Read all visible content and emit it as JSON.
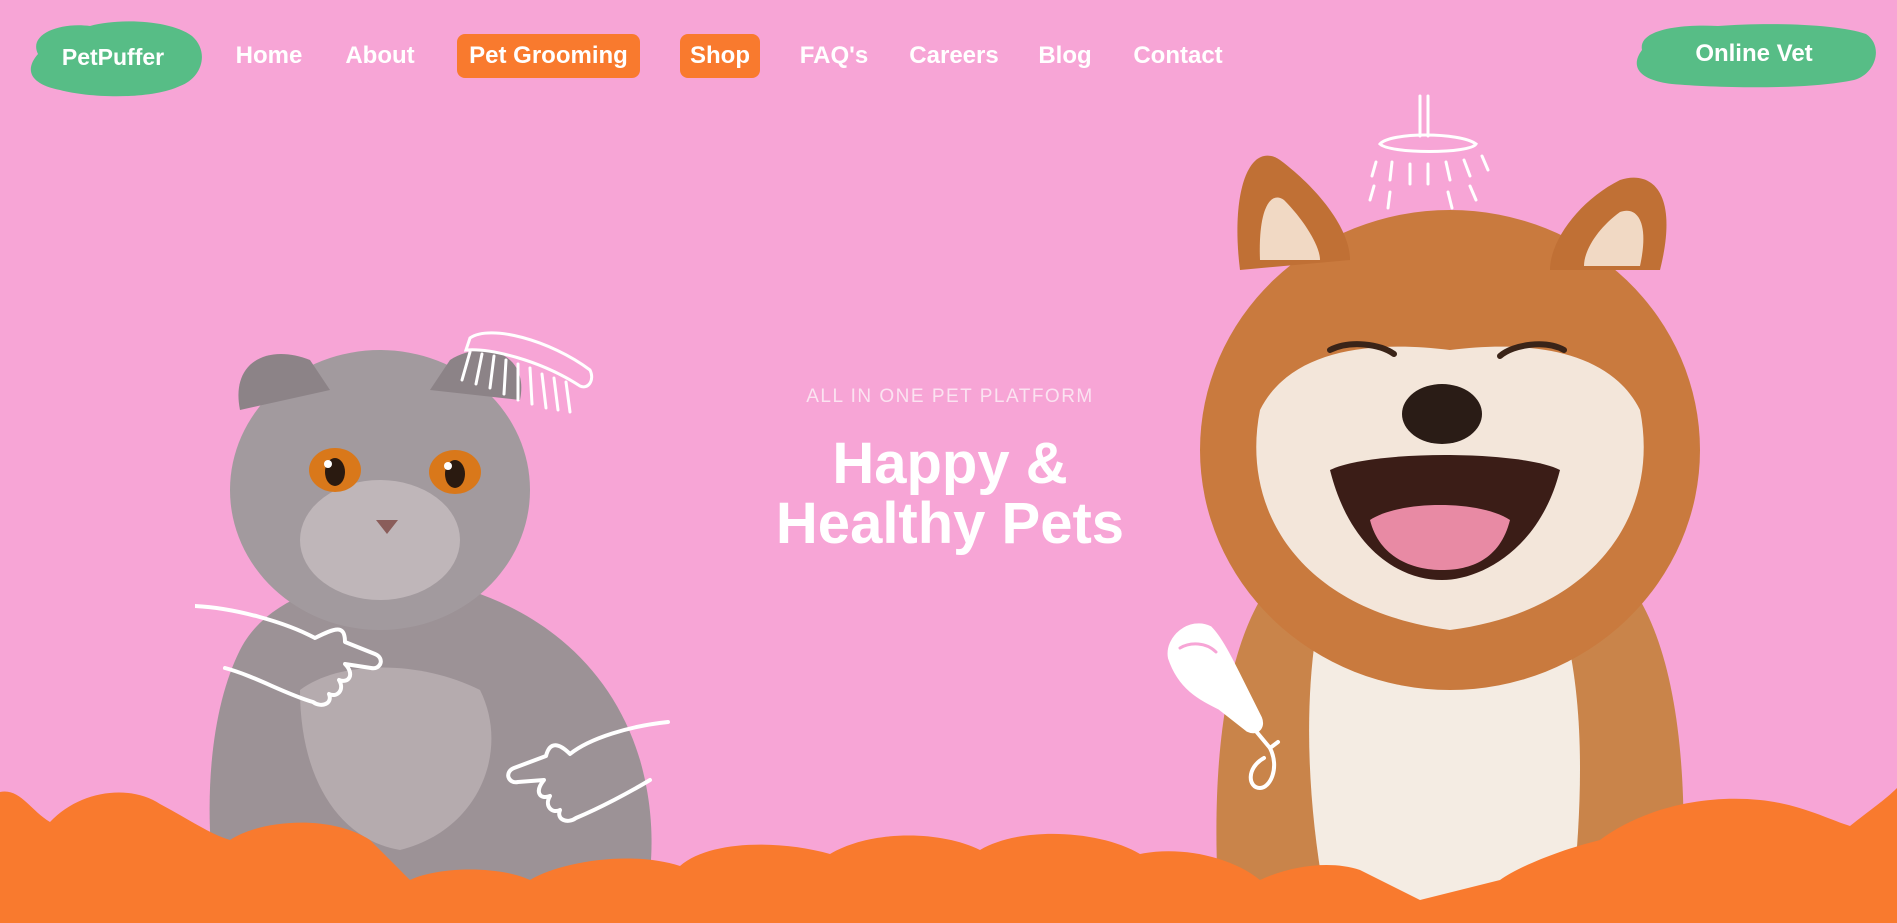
{
  "brand": {
    "logo_text": "PetPuffer"
  },
  "nav": {
    "items": [
      {
        "label": "Home"
      },
      {
        "label": "About"
      },
      {
        "label": "Pet Grooming"
      },
      {
        "label": "Shop"
      },
      {
        "label": "FAQ's"
      },
      {
        "label": "Careers"
      },
      {
        "label": "Blog"
      },
      {
        "label": "Contact"
      }
    ],
    "cta_label": "Online Vet"
  },
  "hero": {
    "eyebrow": "ALL IN ONE PET PLATFORM",
    "headline_line1": "Happy &",
    "headline_line2": "Healthy Pets"
  },
  "colors": {
    "background": "#f7a5d6",
    "accent_orange": "#f97a2e",
    "accent_green": "#57bd86",
    "text": "#ffffff"
  },
  "icons": [
    "comb-icon",
    "shower-icon",
    "pointing-hand-icon",
    "shampoo-bottle-icon"
  ]
}
